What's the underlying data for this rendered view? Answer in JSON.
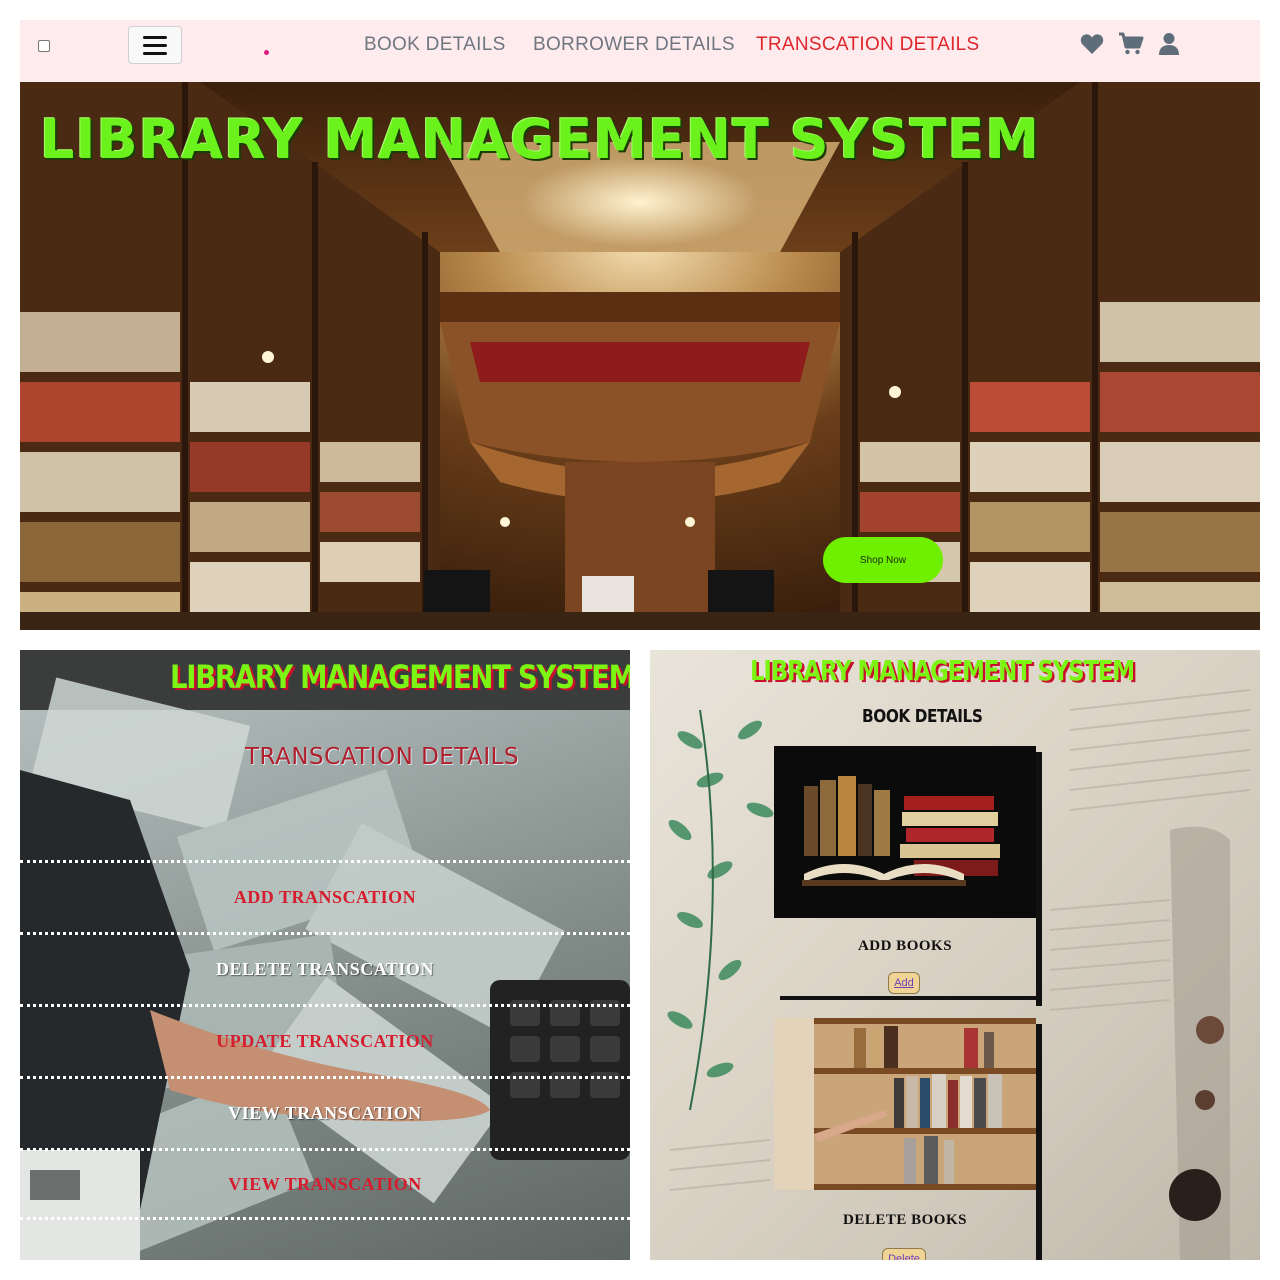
{
  "nav": {
    "links": [
      "BOOK DETAILS",
      "BORROWER DETAILS",
      "TRANSCATION DETAILS"
    ],
    "active_color": "#e0262b",
    "icons": [
      "heart-icon",
      "cart-icon",
      "user-icon"
    ]
  },
  "hero": {
    "title": "LIBRARY MANAGEMENT SYSTEM",
    "button": "Shop Now",
    "title_color": "#6bf21c",
    "button_color": "#6ef000"
  },
  "transactions_panel": {
    "title": "LIBRARY MANAGEMENT SYSTEM",
    "subtitle": "TRANSCATION DETAILS",
    "menu": [
      {
        "label": "ADD TRANSCATION"
      },
      {
        "label": "DELETE TRANSCATION"
      },
      {
        "label": "UPDATE TRANSCATION"
      },
      {
        "label": "VIEW TRANSCATION"
      },
      {
        "label": "VIEW TRANSCATION"
      }
    ]
  },
  "books_panel": {
    "title": "LIBRARY MANAGEMENT SYSTEM",
    "subtitle": "BOOK DETAILS",
    "cards": [
      {
        "caption": "ADD BOOKS",
        "button": "Add"
      },
      {
        "caption": "DELETE BOOKS",
        "button": "Delete"
      }
    ]
  }
}
